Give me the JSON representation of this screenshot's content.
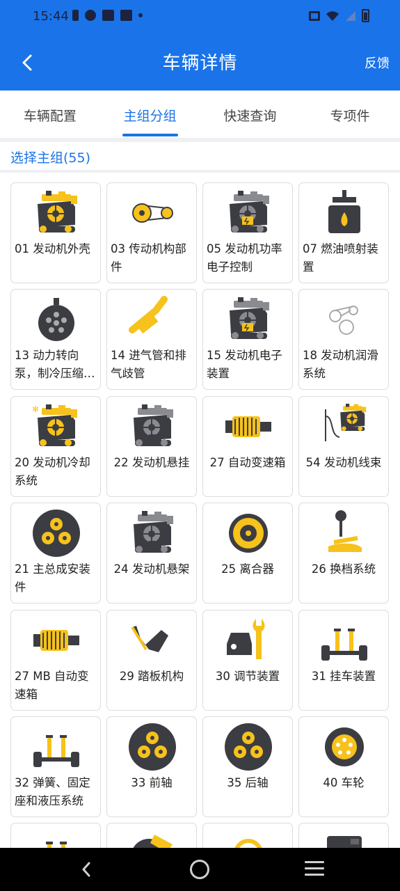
{
  "status_bar": {
    "time": "15:44"
  },
  "header": {
    "title": "车辆详情",
    "feedback": "反馈"
  },
  "tabs": [
    {
      "label": "车辆配置"
    },
    {
      "label": "主组分组"
    },
    {
      "label": "快速查询"
    },
    {
      "label": "专项件"
    }
  ],
  "section": {
    "title": "选择主组(55)"
  },
  "colors": {
    "brand": "#1a73e8",
    "icon_yellow": "#f6c21b",
    "icon_dark": "#3c3d42"
  },
  "groups": [
    {
      "label": "01 发动机外壳",
      "icon": "engine-icon"
    },
    {
      "label": "03 传动机构部件",
      "icon": "belt-drive-icon"
    },
    {
      "label": "05 发动机功率电子控制",
      "icon": "engine-electronic-icon"
    },
    {
      "label": "07 燃油喷射装置",
      "icon": "fuel-injection-icon"
    },
    {
      "label": "13 动力转向泵，制冷压缩…",
      "icon": "pump-pulley-icon"
    },
    {
      "label": "14 进气管和排气歧管",
      "icon": "exhaust-pipe-icon"
    },
    {
      "label": "15 发动机电子装置",
      "icon": "engine-electronic-icon"
    },
    {
      "label": "18 发动机润滑系统",
      "icon": "lubrication-icon"
    },
    {
      "label": "20 发动机冷却系统",
      "icon": "engine-cooling-icon"
    },
    {
      "label": "22 发动机悬挂",
      "icon": "engine-mount-icon"
    },
    {
      "label": "27 自动变速箱",
      "icon": "transmission-icon"
    },
    {
      "label": "54 发动机线束",
      "icon": "wiring-harness-icon"
    },
    {
      "label": "21 主总成安装件",
      "icon": "gears-icon"
    },
    {
      "label": "24 发动机悬架",
      "icon": "engine-mount-icon"
    },
    {
      "label": "25 离合器",
      "icon": "clutch-icon"
    },
    {
      "label": "26 换档系统",
      "icon": "gear-shift-icon"
    },
    {
      "label": "27 MB 自动变速箱",
      "icon": "transmission-icon"
    },
    {
      "label": "29 踏板机构",
      "icon": "pedal-icon"
    },
    {
      "label": "30 调节装置",
      "icon": "car-wrench-icon"
    },
    {
      "label": "31 挂车装置",
      "icon": "axle-icon"
    },
    {
      "label": "32 弹簧、固定座和液压系统",
      "icon": "suspension-icon"
    },
    {
      "label": "33 前轴",
      "icon": "gears-icon"
    },
    {
      "label": "35 后轴",
      "icon": "gears-icon"
    },
    {
      "label": "40 车轮",
      "icon": "wheel-icon"
    }
  ],
  "partial_row": [
    {
      "icon": "axle-icon"
    },
    {
      "icon": "brake-icon"
    },
    {
      "icon": "steering-wheel-icon"
    },
    {
      "icon": "fuel-tank-icon"
    }
  ]
}
